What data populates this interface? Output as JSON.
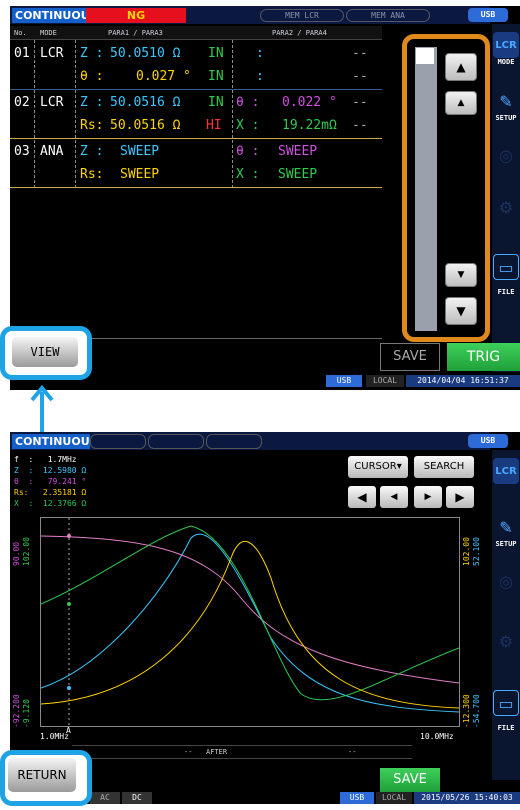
{
  "top": {
    "title": "CONTINUOUS",
    "judgment": "NG",
    "mem_lcr": "MEM LCR",
    "mem_ana": "MEM ANA",
    "usb": "USB",
    "header": {
      "no": "No.",
      "mode": "MODE",
      "para13": "PARA1 / PARA3",
      "para24": "PARA2 / PARA4"
    },
    "rows": [
      {
        "no": "01",
        "mode": "LCR",
        "p1_sym": "Z :",
        "p1_val": "50.0510 Ω",
        "p1_judge": "IN",
        "p2_sym": ":",
        "p2_val": "",
        "p2_judge": "--"
      },
      {
        "no": "",
        "mode": "",
        "p1_sym": "θ :",
        "p1_val": "0.027 °",
        "p1_judge": "IN",
        "p2_sym": ":",
        "p2_val": "",
        "p2_judge": "--"
      },
      {
        "no": "02",
        "mode": "LCR",
        "p1_sym": "Z :",
        "p1_val": "50.0516 Ω",
        "p1_judge": "IN",
        "p2_sym": "θ :",
        "p2_val": "0.022 °",
        "p2_judge": "--"
      },
      {
        "no": "",
        "mode": "",
        "p1_sym": "Rs:",
        "p1_val": "50.0516 Ω",
        "p1_judge": "HI",
        "p2_sym": "X :",
        "p2_val": "19.22mΩ",
        "p2_judge": "--"
      },
      {
        "no": "03",
        "mode": "ANA",
        "p1_sym": "Z :",
        "p1_val": "SWEEP",
        "p1_judge": "",
        "p2_sym": "θ :",
        "p2_val": "SWEEP",
        "p2_judge": ""
      },
      {
        "no": "",
        "mode": "",
        "p1_sym": "Rs:",
        "p1_val": "SWEEP",
        "p1_judge": "",
        "p2_sym": "X :",
        "p2_val": "SWEEP",
        "p2_judge": ""
      }
    ],
    "side": {
      "mode": "MODE",
      "setup": "SETUP",
      "file": "FILE"
    },
    "view": "VIEW",
    "save": "SAVE",
    "trig": "TRIG",
    "status_usb": "USB",
    "status_local": "LOCAL",
    "datetime": "2014/04/04 16:51:37"
  },
  "bottom": {
    "title": "CONTINUOUS",
    "usb": "USB",
    "readout": {
      "freq": "f  :   1.7MHz",
      "z": "Z  :  12.5980 Ω",
      "theta": "θ  :   79.241 °",
      "rs": "Rs:   2.35181 Ω",
      "x": "X  :  12.3766 Ω"
    },
    "cursor": "CURSOR▾",
    "search": "SEARCH",
    "side": {
      "setup": "SETUP",
      "file": "FILE"
    },
    "x_start": "1.0MHz",
    "x_end": "10.0MHz",
    "cursor_label": "A",
    "left_axis_top": [
      "90.00",
      "102.00"
    ],
    "left_axis_bot": [
      "-92.200",
      "-9.120"
    ],
    "right_axis_top": [
      "102.00",
      "52.100"
    ],
    "right_axis_bot": [
      "-12.300",
      "-54.700"
    ],
    "after_left": "--",
    "after": "AFTER",
    "after_right": "--",
    "save": "SAVE",
    "return": "RETURN",
    "bottom_ac": "AC",
    "bottom_dc": "DC",
    "status_usb": "USB",
    "status_local": "LOCAL",
    "datetime": "2015/05/26 15:40:03"
  }
}
